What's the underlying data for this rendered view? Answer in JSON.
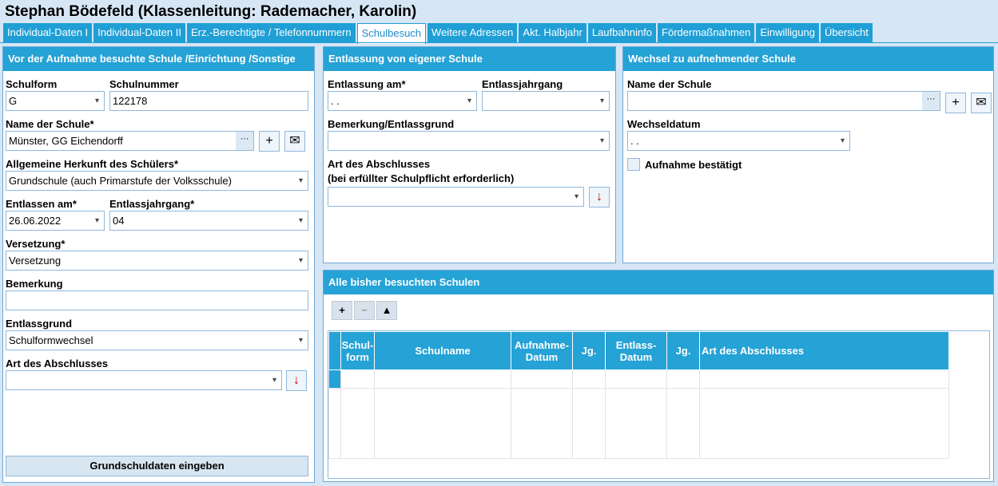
{
  "title": "Stephan Bödefeld (Klassenleitung: Rademacher, Karolin)",
  "tabs": [
    "Individual-Daten I",
    "Individual-Daten II",
    "Erz.-Berechtigte / Telefonnummern",
    "Schulbesuch",
    "Weitere Adressen",
    "Akt. Halbjahr",
    "Laufbahninfo",
    "Fördermaßnahmen",
    "Einwilligung",
    "Übersicht"
  ],
  "left": {
    "header": "Vor der Aufnahme besuchte Schule /Einrichtung /Sonstige",
    "schulform_label": "Schulform",
    "schulform": "G",
    "schulnummer_label": "Schulnummer",
    "schulnummer": "122178",
    "name_label": "Name der Schule*",
    "name": "Münster, GG Eichendorff",
    "herkunft_label": "Allgemeine Herkunft des Schülers*",
    "herkunft": "Grundschule (auch Primarstufe der Volksschule)",
    "entlassen_label": "Entlassen am*",
    "entlassen": "26.06.2022",
    "jahrgang_label": "Entlassjahrgang*",
    "jahrgang": "04",
    "versetzung_label": "Versetzung*",
    "versetzung": "Versetzung",
    "bemerkung_label": "Bemerkung",
    "bemerkung": "",
    "grund_label": "Entlassgrund",
    "grund": "Schulformwechsel",
    "abschluss_label": "Art des Abschlusses",
    "abschluss": "",
    "button": "Grundschuldaten eingeben"
  },
  "mid": {
    "header": "Entlassung von eigener Schule",
    "entlassung_label": "Entlassung am*",
    "entlassung": " .  .",
    "jahrgang_label": "Entlassjahrgang",
    "jahrgang": "",
    "bemerkung_label": "Bemerkung/Entlassgrund",
    "bemerkung": "",
    "abschluss_label": "Art des Abschlusses",
    "abschluss_label2": "(bei erfüllter Schulpflicht erforderlich)",
    "abschluss": ""
  },
  "right": {
    "header": "Wechsel zu aufnehmender Schule",
    "name_label": "Name der Schule",
    "name": "",
    "datum_label": "Wechseldatum",
    "datum": " .  .",
    "checkbox": "Aufnahme bestätigt"
  },
  "table": {
    "header": "Alle bisher besuchten Schulen",
    "columns": [
      "Schul-form",
      "Schulname",
      "Aufnahme-Datum",
      "Jg.",
      "Entlass-Datum",
      "Jg.",
      "Art des Abschlusses"
    ]
  }
}
